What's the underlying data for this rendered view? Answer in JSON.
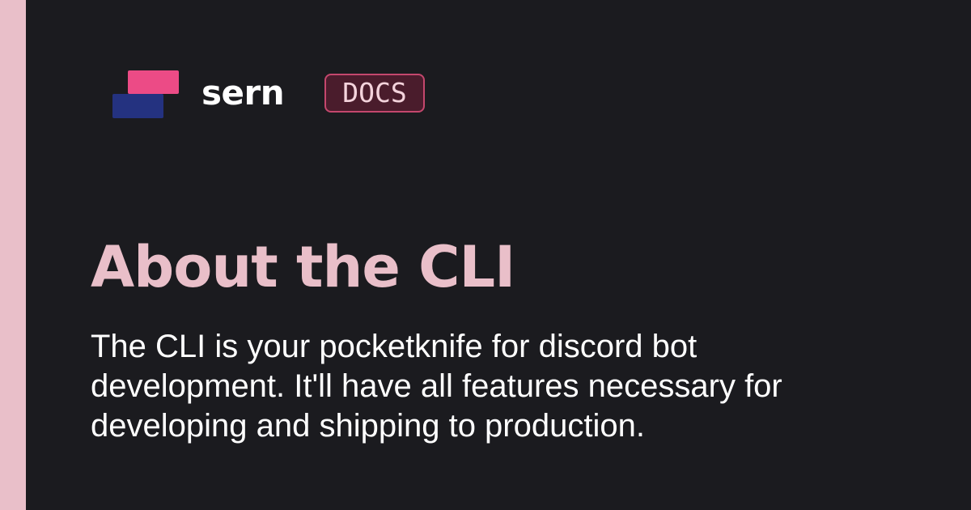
{
  "brand": {
    "name": "sern",
    "badge": "DOCS",
    "logo_icon": "sern-logo-icon"
  },
  "page": {
    "title": "About the CLI",
    "description": "The CLI is your pocketknife for discord bot development. It'll have all features necessary for developing and shipping to production."
  },
  "colors": {
    "background": "#1b1b1f",
    "accent_strip": "#e9bfc9",
    "title": "#e9bfc9",
    "logo_pink": "#ec4b86",
    "logo_blue": "#243280",
    "badge_border": "#c4476d",
    "badge_fill": "#4a1c2c"
  }
}
